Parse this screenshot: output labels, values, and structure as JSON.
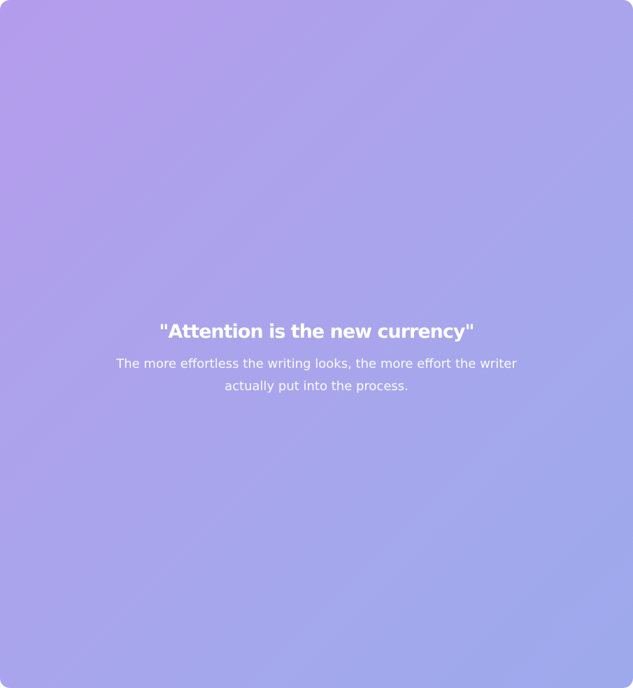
{
  "quote": {
    "title": "\"Attention is the new currency\"",
    "body": "The more effortless the writing looks, the more effort the writer actually put into the process."
  },
  "theme": {
    "gradient_start": "#b59cec",
    "gradient_end": "#9da9ec",
    "text_color": "#ffffff"
  }
}
